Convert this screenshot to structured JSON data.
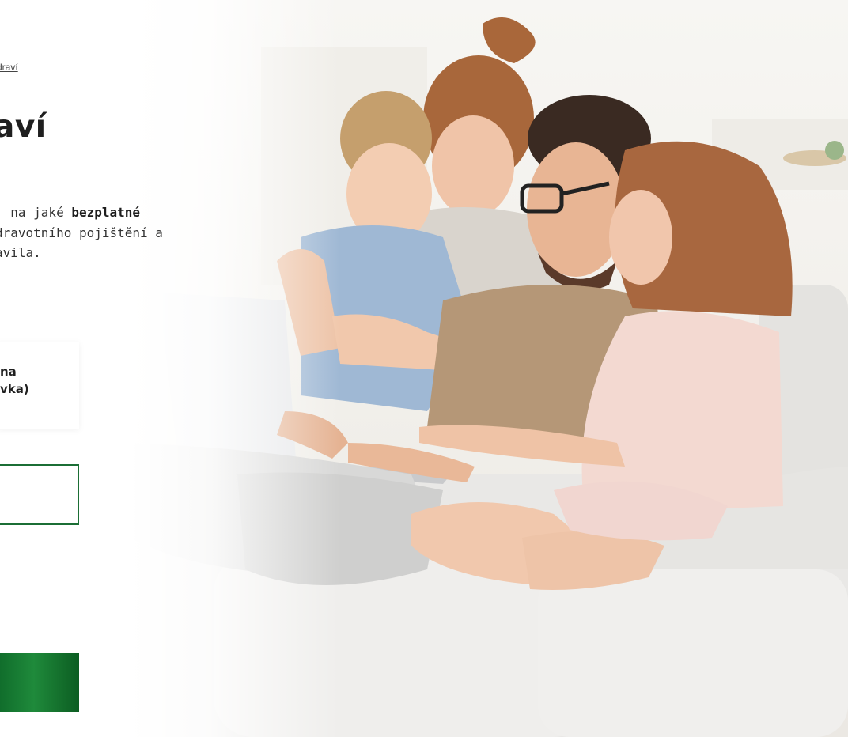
{
  "breadcrumb": {
    "current": "draví"
  },
  "page": {
    "title": "aví"
  },
  "intro": {
    "line1_prefix": ", na jaké ",
    "line1_bold": "bezplatné",
    "line2": "dravotního pojištění a",
    "line3": "avila."
  },
  "card": {
    "label_line1": "na",
    "label_line2": "vka)"
  },
  "colors": {
    "brand_green": "#1b6e35",
    "cta_green": "#1f8a3b"
  }
}
